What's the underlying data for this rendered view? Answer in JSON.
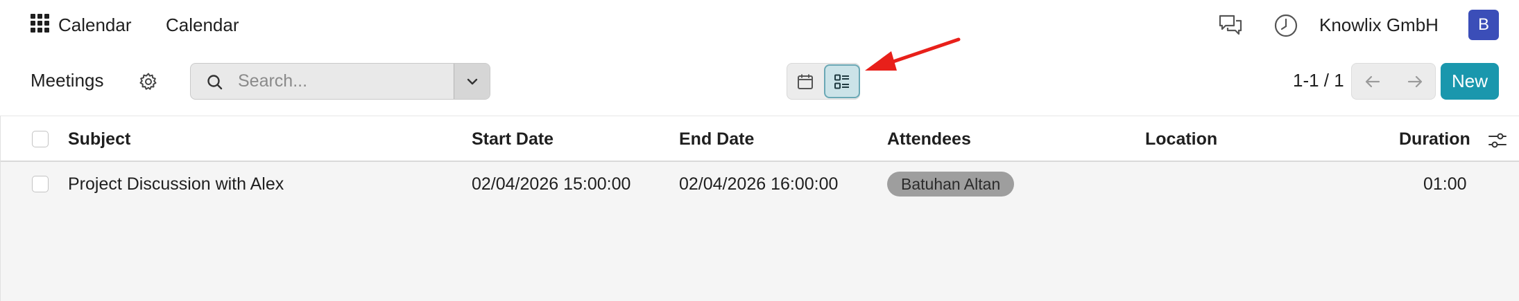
{
  "navbar": {
    "app_name": "Calendar",
    "menu_item": "Calendar",
    "company": "Knowlix GmbH",
    "avatar_initial": "B",
    "icons": [
      "apps-grid-icon",
      "chat-icon",
      "clock-icon"
    ]
  },
  "control_panel": {
    "title": "Meetings",
    "search": {
      "placeholder": "Search...",
      "value": ""
    },
    "views": [
      "calendar",
      "list"
    ],
    "active_view": "list",
    "pager": "1-1 / 1",
    "new_label": "New"
  },
  "list": {
    "columns": [
      "Subject",
      "Start Date",
      "End Date",
      "Attendees",
      "Location",
      "Duration"
    ],
    "rows": [
      {
        "subject": "Project Discussion with Alex",
        "start": "02/04/2026 15:00:00",
        "end": "02/04/2026 16:00:00",
        "attendee": "Batuhan Altan",
        "location": "",
        "duration": "01:00"
      }
    ]
  },
  "colors": {
    "primary": "#1a97ad",
    "avatar": "#3b4eb8",
    "active_view_bg": "#cbe3e8",
    "annotation_arrow": "#e8201a",
    "attendee_tag": "#9e9e9e"
  }
}
